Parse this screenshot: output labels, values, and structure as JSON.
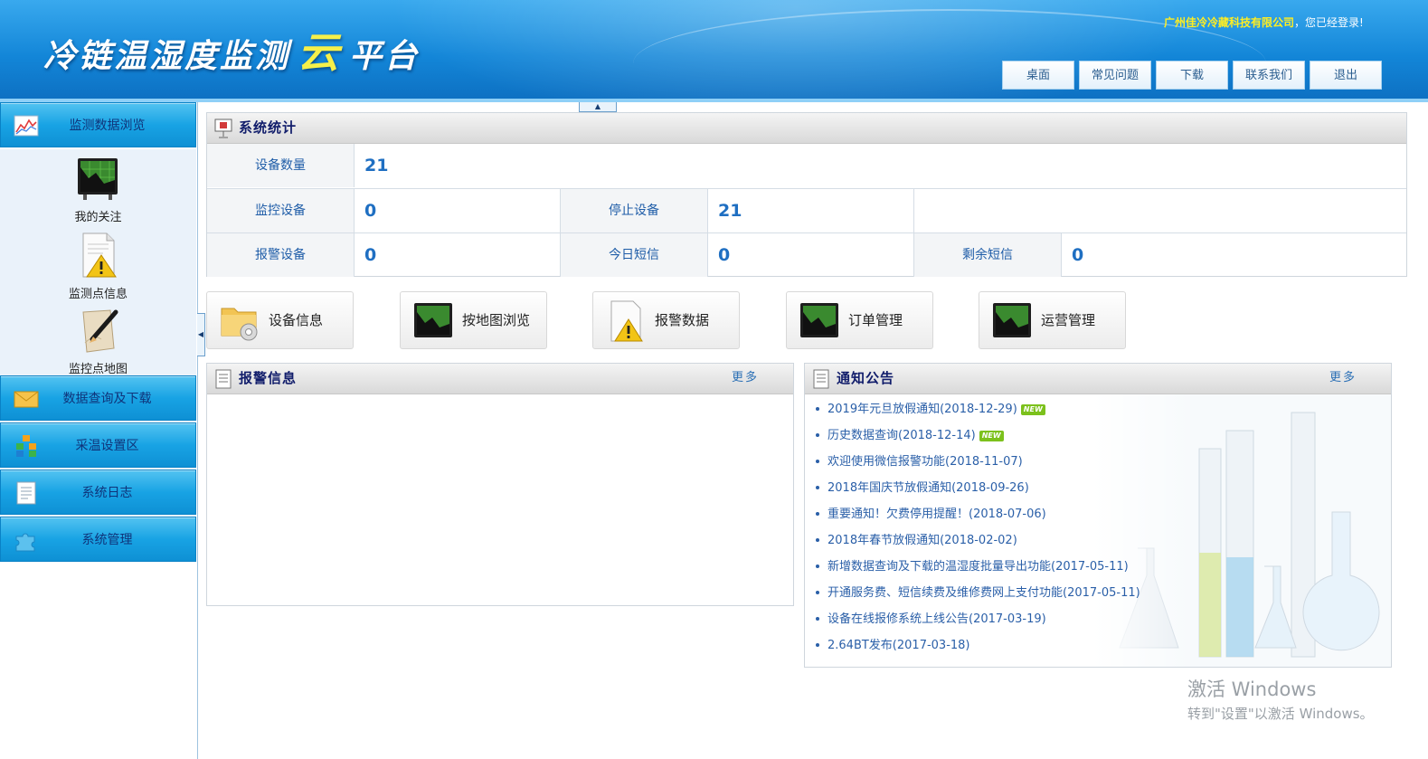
{
  "header": {
    "logo_text_1": "冷链温湿度监测",
    "logo_text_cloud": "云",
    "logo_text_2": "平台",
    "company": "广州佳冷冷藏科技有限公司",
    "welcome_suffix": "，您已经登录!",
    "nav": [
      "桌面",
      "常见问题",
      "下载",
      "联系我们",
      "退出"
    ]
  },
  "sidebar": {
    "menus": [
      {
        "label": "监测数据浏览",
        "icon": "line-chart-icon"
      },
      {
        "label": "数据查询及下载",
        "icon": "envelope-icon"
      },
      {
        "label": "采温设置区",
        "icon": "blocks-icon"
      },
      {
        "label": "系统日志",
        "icon": "log-document-icon"
      },
      {
        "label": "系统管理",
        "icon": "puzzle-icon"
      }
    ],
    "sub_items": [
      {
        "label": "我的关注",
        "icon": "chart-board-icon"
      },
      {
        "label": "监测点信息",
        "icon": "warning-document-icon"
      },
      {
        "label": "监控点地图",
        "icon": "map-pen-icon"
      }
    ]
  },
  "stats": {
    "title": "系统统计",
    "device_count_label": "设备数量",
    "device_count": "21",
    "monitor_label": "监控设备",
    "monitor_value": "0",
    "stopped_label": "停止设备",
    "stopped_value": "21",
    "alarm_label": "报警设备",
    "alarm_value": "0",
    "sms_today_label": "今日短信",
    "sms_today_value": "0",
    "sms_remaining_label": "剩余短信",
    "sms_remaining_value": "0"
  },
  "quick_links": [
    {
      "label": "设备信息",
      "icon": "folder-gear-icon"
    },
    {
      "label": "按地图浏览",
      "icon": "chart-board-icon"
    },
    {
      "label": "报警数据",
      "icon": "warning-document-icon"
    },
    {
      "label": "订单管理",
      "icon": "chart-board-icon"
    },
    {
      "label": "运营管理",
      "icon": "chart-board-icon"
    }
  ],
  "alarm_panel": {
    "title": "报警信息",
    "more": "更多"
  },
  "notice_panel": {
    "title": "通知公告",
    "more": "更多",
    "new_badge": "NEW",
    "items": [
      {
        "text": "2019年元旦放假通知(2018-12-29)",
        "is_new": true
      },
      {
        "text": "历史数据查询(2018-12-14)",
        "is_new": true
      },
      {
        "text": "欢迎使用微信报警功能(2018-11-07)",
        "is_new": false
      },
      {
        "text": "2018年国庆节放假通知(2018-09-26)",
        "is_new": false
      },
      {
        "text": "重要通知！欠费停用提醒！(2018-07-06)",
        "is_new": false
      },
      {
        "text": "2018年春节放假通知(2018-02-02)",
        "is_new": false
      },
      {
        "text": "新增数据查询及下载的温湿度批量导出功能(2017-05-11)",
        "is_new": false
      },
      {
        "text": "开通服务费、短信续费及维修费网上支付功能(2017-05-11)",
        "is_new": false
      },
      {
        "text": "设备在线报修系统上线公告(2017-03-19)",
        "is_new": false
      },
      {
        "text": "2.64BT发布(2017-03-18)",
        "is_new": false
      }
    ]
  },
  "watermark": {
    "line1": "激活 Windows",
    "line2": "转到\"设置\"以激活 Windows。"
  }
}
